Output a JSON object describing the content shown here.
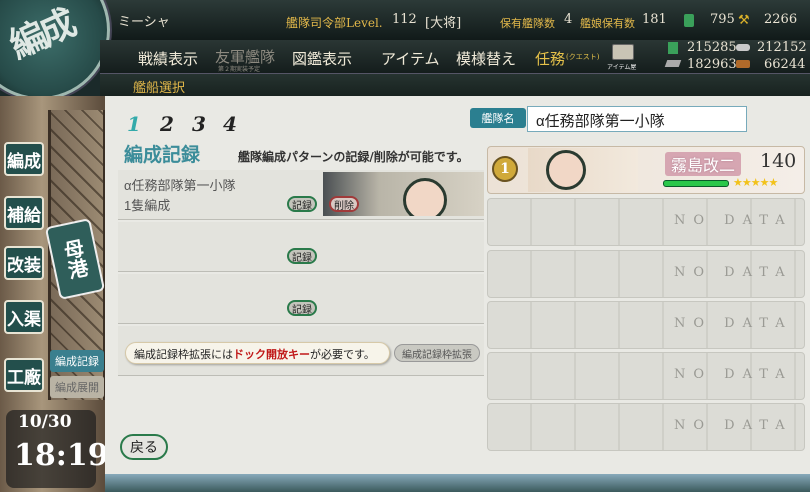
{
  "header": {
    "player_name": "ミーシャ",
    "level_label": "艦隊司令部Level.",
    "level": "112",
    "rank": "[大将]",
    "fleet_count_label": "保有艦隊数",
    "fleet_count": "4",
    "ship_count_label": "艦娘保有数",
    "ship_count": "181",
    "bucket": "795",
    "dev_material": "2266",
    "fuel": "215285",
    "ammo": "212152",
    "steel": "182963",
    "bauxite": "66244"
  },
  "menu": {
    "items": [
      "戦績表示",
      "友軍艦隊",
      "図鑑表示",
      "アイテム",
      "模様替え",
      "任務"
    ],
    "friend_sub": "第２期実装予定",
    "quest_sub": "(クエスト)",
    "shop_label": "アイテム屋",
    "sub_title": "艦船選択"
  },
  "emblem": "編成",
  "sidebar": {
    "buttons": [
      "編成",
      "補給",
      "改装",
      "入渠",
      "工廠"
    ],
    "home": "母港",
    "tab_active": "編成記録",
    "tab_inactive": "編成展開",
    "date": "10/30",
    "time": "18:19"
  },
  "fleet_tabs": [
    "1",
    "2",
    "3",
    "4"
  ],
  "name_label": "艦隊名",
  "fleet_name": "α任務部隊第一小隊",
  "record": {
    "title": "編成記録",
    "description": "艦隊編成パターンの記録/削除が可能です。",
    "slot1_name": "α任務部隊第一小隊",
    "slot1_count": "1隻編成",
    "record_btn": "記録",
    "delete_btn": "削除",
    "hint_prefix": "編成記録枠拡張には",
    "hint_key": "ドック開放キー",
    "hint_suffix": "が必要です。",
    "expand_btn": "編成記録枠拡張",
    "back_btn": "戻る"
  },
  "ship": {
    "name": "霧島改二",
    "level": "140",
    "stars": "★★★★★",
    "flag": "1"
  },
  "empty_slot": "NO DATA"
}
